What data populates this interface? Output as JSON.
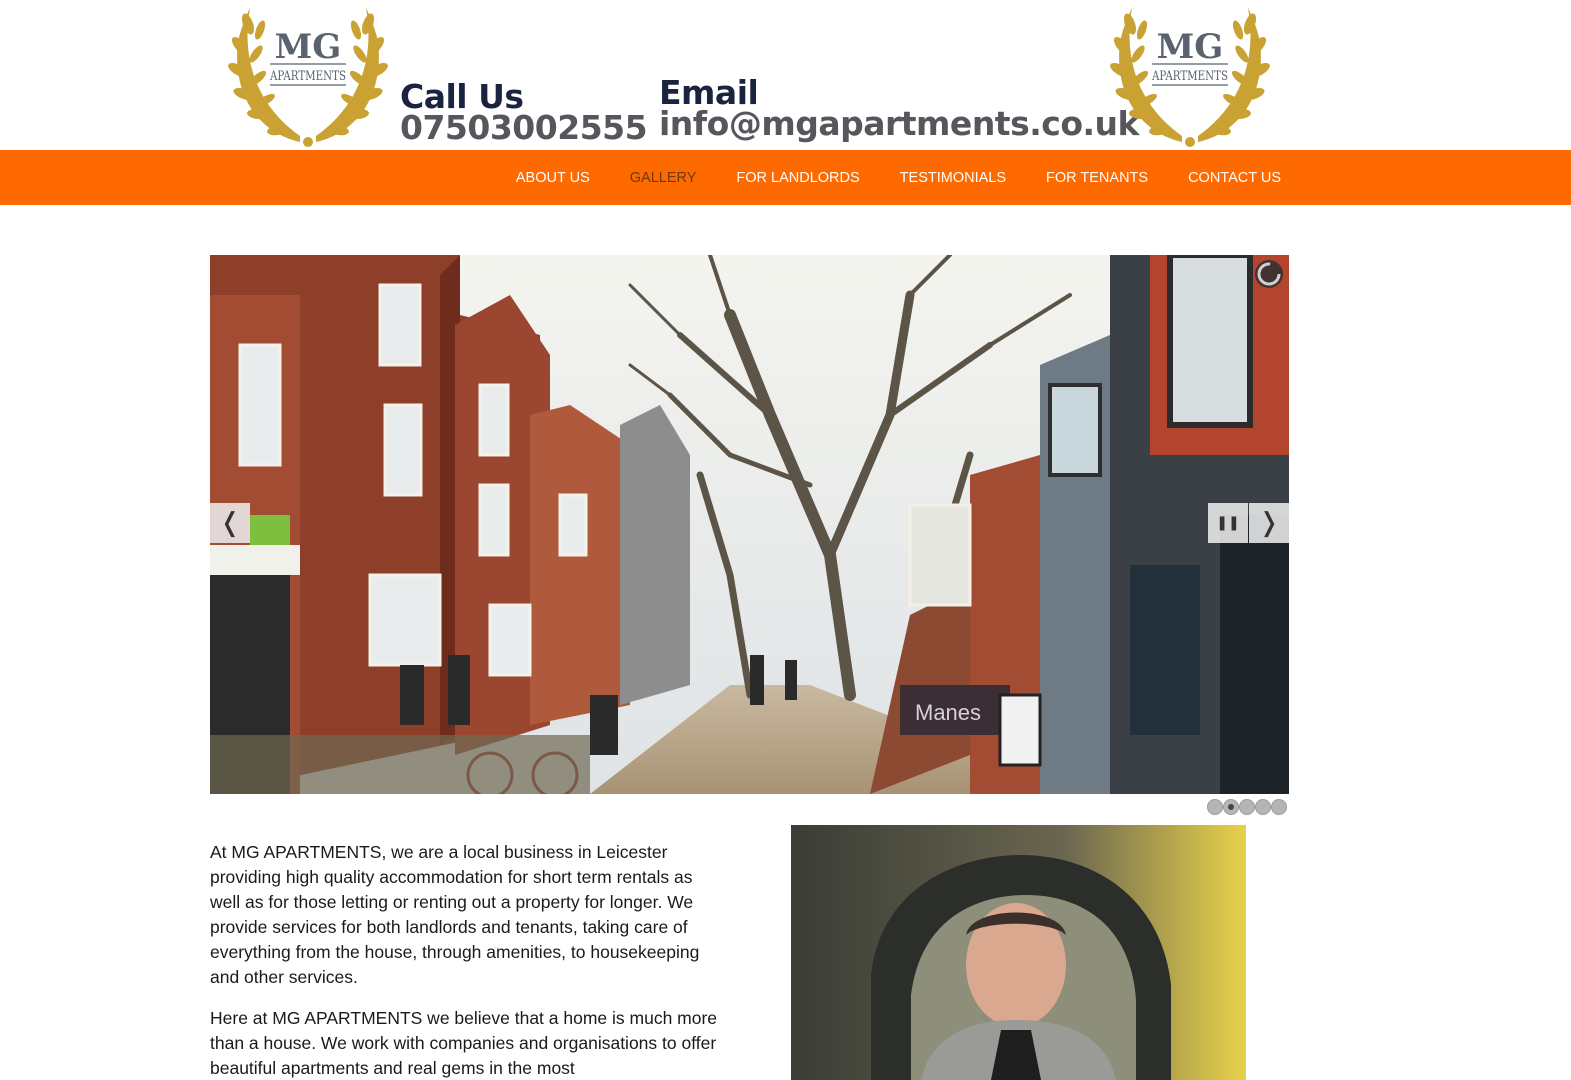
{
  "header": {
    "logo": {
      "line1": "MG",
      "line2": "APARTMENTS"
    },
    "call": {
      "label": "Call Us",
      "value": "07503002555"
    },
    "email": {
      "label": "Email",
      "value": "info@mgapartments.co.uk"
    }
  },
  "nav": {
    "items": [
      {
        "label": "ABOUT US",
        "active": false
      },
      {
        "label": "GALLERY",
        "active": true
      },
      {
        "label": "FOR LANDLORDS",
        "active": false
      },
      {
        "label": "TESTIMONIALS",
        "active": false
      },
      {
        "label": "FOR TENANTS",
        "active": false
      },
      {
        "label": "CONTACT US",
        "active": false
      }
    ]
  },
  "slider": {
    "prev_icon": "chevron-left-icon",
    "next_icon": "chevron-right-icon",
    "pause_icon": "pause-icon",
    "prev_glyph": "❬",
    "next_glyph": "❭",
    "pause_glyph": "❚❚",
    "slide_count": 5,
    "active_slide": 2,
    "shop_sign": "Manes"
  },
  "intro": {
    "paragraph1": "At MG APARTMENTS, we are a local business in Leicester providing high quality accommodation for short term rentals as well as for those letting or renting out a property for longer. We provide services for both landlords and tenants, taking care of everything from the house, through amenities, to housekeeping and other services.",
    "paragraph2": "Here at MG APARTMENTS we believe that a home is much more than a house. We work with companies and organisations to offer beautiful apartments and real gems in the most"
  },
  "colors": {
    "nav_bg": "#ff6a00",
    "nav_text": "#ffffff",
    "nav_active": "#6b3a10",
    "contact_label": "#1a2440",
    "contact_value": "#55575c",
    "laurel_gold": "#c9a233"
  }
}
